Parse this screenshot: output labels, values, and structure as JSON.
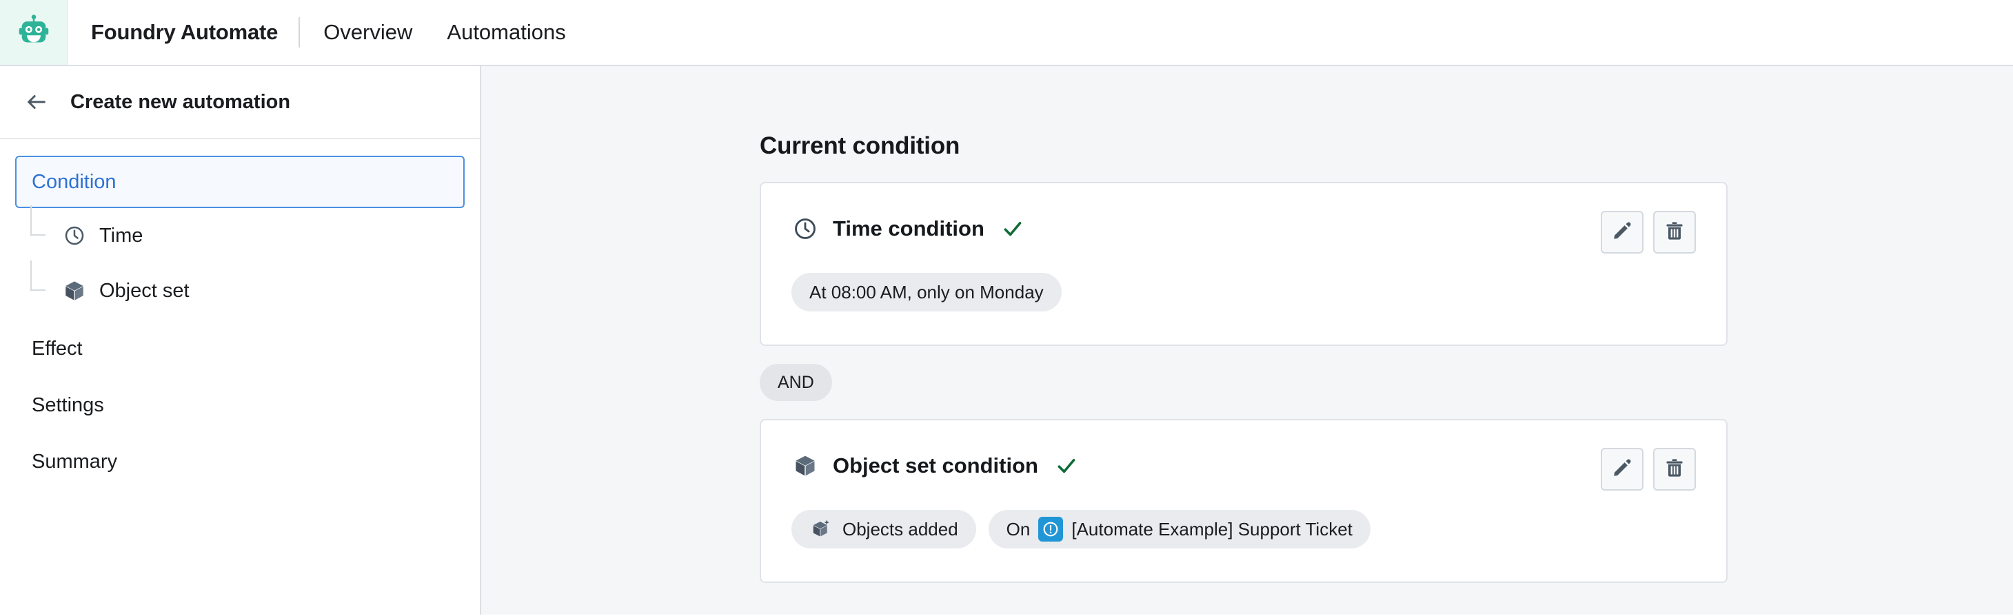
{
  "topnav": {
    "logo_icon": "robot-icon",
    "logo_bg": "#eaf8f3",
    "logo_color": "#2eb398",
    "app_title": "Foundry Automate",
    "links": [
      {
        "label": "Overview"
      },
      {
        "label": "Automations"
      }
    ]
  },
  "sidebar": {
    "back_icon": "arrow-left-icon",
    "header_title": "Create new automation",
    "selected_item": "Condition",
    "items": [
      {
        "label": "Condition",
        "selected": true,
        "children": [
          {
            "label": "Time",
            "icon": "clock-icon"
          },
          {
            "label": "Object set",
            "icon": "cube-icon"
          }
        ]
      },
      {
        "label": "Effect",
        "selected": false,
        "children": []
      },
      {
        "label": "Settings",
        "selected": false,
        "children": []
      },
      {
        "label": "Summary",
        "selected": false,
        "children": []
      }
    ]
  },
  "main": {
    "section_title": "Current condition",
    "operator_badge": "AND",
    "cards": [
      {
        "icon": "clock-icon",
        "title": "Time condition",
        "status_icon": "check-icon",
        "status_color": "#0d6b35",
        "edit_icon": "pencil-icon",
        "delete_icon": "trash-icon",
        "pills": [
          {
            "text": "At 08:00 AM, only on Monday"
          }
        ]
      },
      {
        "icon": "cube-icon",
        "title": "Object set condition",
        "status_icon": "check-icon",
        "status_color": "#0d6b35",
        "edit_icon": "pencil-icon",
        "delete_icon": "trash-icon",
        "pills": [
          {
            "icon": "cube-add-icon",
            "text": "Objects added"
          },
          {
            "prefix": "On",
            "badge_icon": "alert-circle-icon",
            "badge_color": "#2196d6",
            "text": "[Automate Example] Support Ticket"
          }
        ]
      }
    ]
  },
  "colors": {
    "accent_blue": "#2d72d2",
    "selected_bg": "#f6f9fe",
    "selected_border": "#4a90e2",
    "main_bg": "#f4f6f8",
    "card_border": "#dfe3e8",
    "pill_bg": "#e9ebee",
    "icon_slate": "#4c5a67"
  }
}
